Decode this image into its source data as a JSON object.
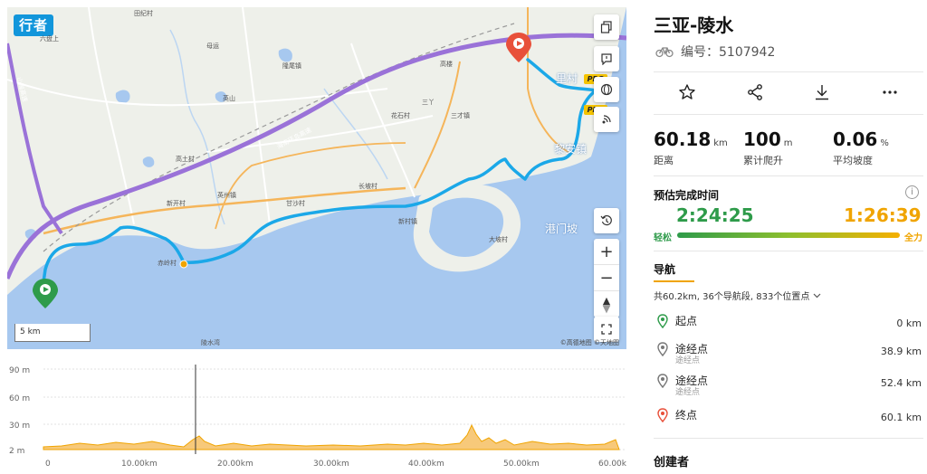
{
  "map": {
    "brand": "行者",
    "scale": "5 km",
    "credit": "©高德地图 ©天地图",
    "labels": [
      {
        "text": "田纪村",
        "cls": ""
      },
      {
        "text": "六盘上",
        "cls": ""
      },
      {
        "text": "母运",
        "cls": ""
      },
      {
        "text": "英山",
        "cls": ""
      },
      {
        "text": "隆尾镇",
        "cls": ""
      },
      {
        "text": "高楼",
        "cls": ""
      },
      {
        "text": "三丫",
        "cls": ""
      },
      {
        "text": "花石村",
        "cls": ""
      },
      {
        "text": "三才镇",
        "cls": ""
      },
      {
        "text": "高土村",
        "cls": ""
      },
      {
        "text": "新开村",
        "cls": ""
      },
      {
        "text": "英州镇",
        "cls": ""
      },
      {
        "text": "赤岭村",
        "cls": ""
      },
      {
        "text": "甘沙村",
        "cls": ""
      },
      {
        "text": "长坡村",
        "cls": ""
      },
      {
        "text": "新村镇",
        "cls": ""
      },
      {
        "text": "大坡村",
        "cls": ""
      },
      {
        "text": "里村",
        "cls": "big"
      },
      {
        "text": "黎安镇",
        "cls": "big"
      },
      {
        "text": "港门坡",
        "cls": "big"
      },
      {
        "text": "陵水湾",
        "cls": ""
      },
      {
        "text": "海南环岛高速",
        "cls": ""
      },
      {
        "text": "山海高速",
        "cls": ""
      }
    ],
    "pro_badges": [
      "PRO",
      "PRO"
    ],
    "controls": {
      "zoom_in": "+",
      "zoom_out": "−"
    }
  },
  "elevation": {
    "y_ticks": [
      "90 m",
      "60 m",
      "30 m",
      "2 m"
    ],
    "x_ticks": [
      "0",
      "10.00km",
      "20.00km",
      "30.00km",
      "40.00km",
      "50.00km",
      "60.00km"
    ],
    "cursor_km": 16.2
  },
  "route": {
    "title": "三亚-陵水",
    "id_label": "编号：5107942",
    "stats": [
      {
        "value": "60.18",
        "unit": "km",
        "label": "距离"
      },
      {
        "value": "100",
        "unit": "m",
        "label": "累计爬升"
      },
      {
        "value": "0.06",
        "unit": "%",
        "label": "平均坡度"
      }
    ],
    "estimate": {
      "title": "预估完成时间",
      "easy_time": "2:24:25",
      "full_time": "1:26:39",
      "easy_label": "轻松",
      "full_label": "全力"
    },
    "nav": {
      "tab": "导航",
      "summary": "共60.2km, 36个导航段, 833个位置点",
      "waypoints": [
        {
          "name": "起点",
          "sub": "",
          "dist": "0 km"
        },
        {
          "name": "途经点",
          "sub": "途经点",
          "dist": "38.9 km"
        },
        {
          "name": "途经点",
          "sub": "途经点",
          "dist": "52.4 km"
        },
        {
          "name": "终点",
          "sub": "",
          "dist": "60.1 km"
        }
      ]
    },
    "creator": "创建者"
  }
}
